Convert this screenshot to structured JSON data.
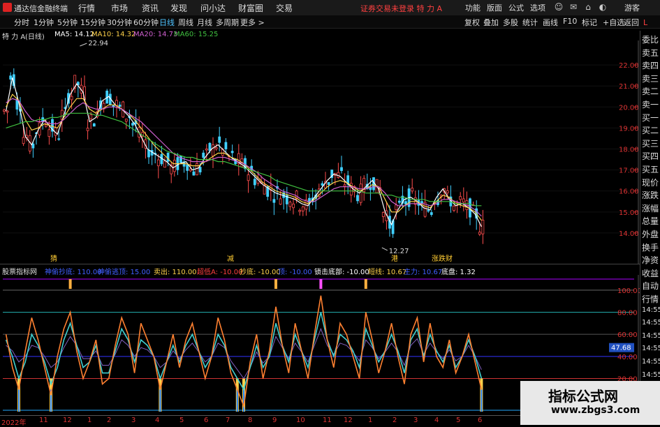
{
  "titlebar": {
    "app_name": "通达信金融终端",
    "menu": [
      "行情",
      "市场",
      "资讯",
      "发现",
      "问小达",
      "财富圈",
      "交易"
    ],
    "warning": "证券交易未登录 特 力 A",
    "right_menu": [
      "功能",
      "版面",
      "公式",
      "选项"
    ],
    "login": "游客",
    "minimize": "—",
    "restore": "❐",
    "close": "✕"
  },
  "toolbar": {
    "periods": [
      "分时",
      "1分钟",
      "5分钟",
      "15分钟",
      "30分钟",
      "60分钟",
      "日线",
      "周线",
      "月线",
      "多周期",
      "更多 >"
    ],
    "active_period": "日线",
    "right_tools": [
      "复权",
      "叠加",
      "多股",
      "统计",
      "画线",
      "F10",
      "标记",
      "+自选",
      "返回"
    ]
  },
  "chart_header": {
    "stock": "特 力 A",
    "period": "(日线)",
    "ma5": "MA5: 14.12",
    "ma10": "MA10: 14.32",
    "ma20": "MA20: 14.73",
    "ma60": "MA60: 15.25",
    "colors": {
      "ma5": "#ffffff",
      "ma10": "#ffd24a",
      "ma20": "#d060d0",
      "ma60": "#40c040"
    }
  },
  "price_annotations": {
    "high": "22.94",
    "low": "12.27"
  },
  "signal_labels": [
    {
      "text": "猜",
      "color": "#ffcc33"
    },
    {
      "text": "减",
      "color": "#ffcc33"
    },
    {
      "text": "港",
      "color": "#ffcc33"
    },
    {
      "text": "涨跌财",
      "color": "#ffcc33"
    }
  ],
  "indicator_header": {
    "name": "股票指标网",
    "items": [
      {
        "label": "神偷抄底",
        "value": "110.00",
        "color": "#4060ff"
      },
      {
        "label": "神偷逃顶",
        "value": "15.00",
        "color": "#4060ff"
      },
      {
        "label": "卖出",
        "value": "110.00",
        "color": "#ffd24a"
      },
      {
        "label": "超低A",
        "value": "-10.00",
        "color": "#ff4040"
      },
      {
        "label": "抄底",
        "value": "-10.00",
        "color": "#ffd24a"
      },
      {
        "label": "顶",
        "value": "-10.00",
        "color": "#4060ff"
      },
      {
        "label": "锁击底部",
        "value": "-10.00",
        "color": "#ffffff"
      },
      {
        "label": "短线",
        "value": "10.67",
        "color": "#ffd24a"
      },
      {
        "label": "主力",
        "value": "10.67",
        "color": "#4060ff"
      },
      {
        "label": "底盘",
        "value": "1.32",
        "color": "#ffffff"
      }
    ]
  },
  "price_axis": [
    "22.00",
    "21.00",
    "20.00",
    "19.00",
    "18.00",
    "17.00",
    "16.00",
    "15.00",
    "14.00"
  ],
  "indicator_axis": [
    "100.00",
    "80.00",
    "60.00",
    "40.00",
    "20.00"
  ],
  "indicator_current": "47.68",
  "sidebar": [
    "委比",
    "卖五",
    "卖四",
    "卖三",
    "卖二",
    "卖一",
    "买一",
    "买二",
    "买三",
    "买四",
    "买五",
    "现价",
    "涨跌",
    "涨幅",
    "总量",
    "外盘",
    "换手",
    "净资",
    "收益",
    "自动",
    "行情",
    "14:55",
    "14:55",
    "14:55",
    "14:55",
    "14:55",
    "14:55",
    "14:55",
    "14:55"
  ],
  "sidebar_top": "L",
  "date_axis": [
    "2022年",
    "11",
    "12",
    "1",
    "2",
    "3",
    "4",
    "5",
    "6",
    "7",
    "8",
    "9",
    "10",
    "11",
    "12",
    "1",
    "2",
    "3",
    "4",
    "5",
    "6"
  ],
  "watermark": {
    "line1": "指标公式网",
    "line2": "www.zbgs3.com"
  },
  "chart_data": [
    {
      "type": "line",
      "title": "特 力 A (日线)",
      "ylim": [
        13.2,
        22.9
      ],
      "series": [
        {
          "name": "MA5",
          "color": "#ffffff",
          "values": [
            19.8,
            21.4,
            20.2,
            18.6,
            18.2,
            18.9,
            19.4,
            19.0,
            18.7,
            19.6,
            20.6,
            21.1,
            20.7,
            19.3,
            19.5,
            20.3,
            20.5,
            20.1,
            19.9,
            19.6,
            19.2,
            18.6,
            18.0,
            17.8,
            17.6,
            17.4,
            17.1,
            17.3,
            17.4,
            17.0,
            17.1,
            17.6,
            18.0,
            18.2,
            17.9,
            17.6,
            17.4,
            17.2,
            16.9,
            16.6,
            16.3,
            16.1,
            15.9,
            15.8,
            15.7,
            15.6,
            15.4,
            15.3,
            15.7,
            16.1,
            16.5,
            16.8,
            16.7,
            16.4,
            16.1,
            15.9,
            16.2,
            16.5,
            16.1,
            15.0,
            14.4,
            15.1,
            15.6,
            15.7,
            15.5,
            15.2,
            15.1,
            15.7,
            16.1,
            15.6,
            15.3,
            15.4,
            15.2,
            14.9,
            14.3
          ]
        },
        {
          "name": "MA10",
          "color": "#ffd24a",
          "values": [
            20.0,
            20.6,
            20.3,
            19.4,
            18.9,
            19.0,
            19.2,
            19.1,
            19.0,
            19.5,
            20.0,
            20.4,
            20.4,
            19.9,
            19.7,
            19.9,
            20.1,
            20.1,
            19.9,
            19.7,
            19.4,
            19.0,
            18.6,
            18.2,
            17.9,
            17.6,
            17.3,
            17.3,
            17.3,
            17.2,
            17.2,
            17.4,
            17.6,
            17.8,
            17.8,
            17.6,
            17.5,
            17.3,
            17.0,
            16.7,
            16.4,
            16.2,
            16.0,
            15.9,
            15.8,
            15.7,
            15.5,
            15.4,
            15.6,
            15.9,
            16.2,
            16.4,
            16.5,
            16.4,
            16.2,
            16.0,
            16.1,
            16.3,
            16.2,
            15.6,
            15.0,
            15.0,
            15.3,
            15.5,
            15.5,
            15.3,
            15.2,
            15.5,
            15.8,
            15.7,
            15.4,
            15.3,
            15.2,
            15.0,
            14.6
          ]
        },
        {
          "name": "MA20",
          "color": "#d060d0",
          "values": [
            20.2,
            20.4,
            20.3,
            19.8,
            19.4,
            19.3,
            19.3,
            19.2,
            19.2,
            19.4,
            19.7,
            20.0,
            20.2,
            20.0,
            19.9,
            19.9,
            20.0,
            20.0,
            19.9,
            19.7,
            19.5,
            19.3,
            19.0,
            18.7,
            18.4,
            18.1,
            17.8,
            17.6,
            17.5,
            17.4,
            17.4,
            17.4,
            17.5,
            17.6,
            17.6,
            17.5,
            17.4,
            17.3,
            17.1,
            16.9,
            16.6,
            16.4,
            16.2,
            16.0,
            15.9,
            15.8,
            15.6,
            15.5,
            15.5,
            15.7,
            15.9,
            16.1,
            16.2,
            16.2,
            16.2,
            16.1,
            16.1,
            16.2,
            16.2,
            15.9,
            15.5,
            15.3,
            15.3,
            15.4,
            15.4,
            15.4,
            15.3,
            15.4,
            15.6,
            15.6,
            15.5,
            15.4,
            15.3,
            15.1,
            14.8
          ]
        },
        {
          "name": "MA60",
          "color": "#40c040",
          "values": [
            19.0,
            19.1,
            19.2,
            19.3,
            19.3,
            19.4,
            19.4,
            19.5,
            19.5,
            19.6,
            19.7,
            19.7,
            19.7,
            19.7,
            19.6,
            19.6,
            19.5,
            19.4,
            19.3,
            19.1,
            18.9,
            18.7,
            18.5,
            18.3,
            18.1,
            17.9,
            17.8,
            17.7,
            17.6,
            17.6,
            17.5,
            17.5,
            17.5,
            17.4,
            17.4,
            17.3,
            17.2,
            17.1,
            17.0,
            16.9,
            16.8,
            16.7,
            16.5,
            16.4,
            16.3,
            16.2,
            16.1,
            16.0,
            16.0,
            16.0,
            16.0,
            16.0,
            16.0,
            16.0,
            16.0,
            16.0,
            15.9,
            15.9,
            15.9,
            15.8,
            15.8,
            15.7,
            15.7,
            15.6,
            15.6,
            15.6,
            15.5,
            15.5,
            15.5,
            15.5,
            15.4,
            15.4,
            15.4,
            15.3,
            15.3
          ]
        }
      ]
    },
    {
      "type": "line",
      "title": "股票指标网",
      "ylim": [
        -10,
        110
      ],
      "series": [
        {
          "name": "短线",
          "color": "#ff8030",
          "values": [
            60,
            30,
            10,
            45,
            75,
            55,
            30,
            5,
            40,
            65,
            80,
            45,
            20,
            35,
            55,
            15,
            20,
            50,
            75,
            60,
            25,
            70,
            55,
            40,
            10,
            35,
            60,
            30,
            55,
            70,
            45,
            20,
            40,
            75,
            55,
            25,
            10,
            -5,
            35,
            60,
            20,
            45,
            85,
            50,
            25,
            70,
            45,
            20,
            60,
            95,
            55,
            30,
            70,
            60,
            40,
            20,
            80,
            55,
            25,
            45,
            70,
            40,
            15,
            60,
            75,
            35,
            70,
            40,
            30,
            55,
            25,
            40,
            60,
            35,
            10
          ]
        },
        {
          "name": "主力",
          "color": "#40d0d0",
          "values": [
            55,
            40,
            20,
            35,
            60,
            50,
            35,
            15,
            30,
            55,
            70,
            50,
            30,
            35,
            50,
            25,
            25,
            45,
            65,
            55,
            35,
            55,
            50,
            40,
            20,
            35,
            50,
            35,
            50,
            60,
            45,
            30,
            40,
            60,
            50,
            30,
            20,
            10,
            30,
            50,
            30,
            40,
            70,
            50,
            35,
            60,
            45,
            30,
            55,
            80,
            55,
            40,
            60,
            55,
            45,
            30,
            65,
            50,
            35,
            45,
            60,
            45,
            25,
            55,
            65,
            40,
            60,
            45,
            35,
            50,
            30,
            40,
            55,
            40,
            20
          ]
        },
        {
          "name": "底盘",
          "color": "#8060c0",
          "values": [
            50,
            45,
            35,
            40,
            50,
            48,
            40,
            30,
            35,
            48,
            58,
            50,
            38,
            38,
            45,
            32,
            32,
            42,
            55,
            50,
            40,
            48,
            46,
            40,
            30,
            35,
            45,
            38,
            46,
            52,
            44,
            35,
            40,
            52,
            48,
            36,
            28,
            20,
            30,
            44,
            34,
            40,
            58,
            48,
            38,
            52,
            44,
            35,
            50,
            65,
            50,
            42,
            52,
            50,
            44,
            36,
            55,
            48,
            38,
            44,
            52,
            44,
            32,
            50,
            56,
            42,
            52,
            44,
            38,
            46,
            36,
            40,
            50,
            40,
            28
          ]
        }
      ]
    }
  ]
}
